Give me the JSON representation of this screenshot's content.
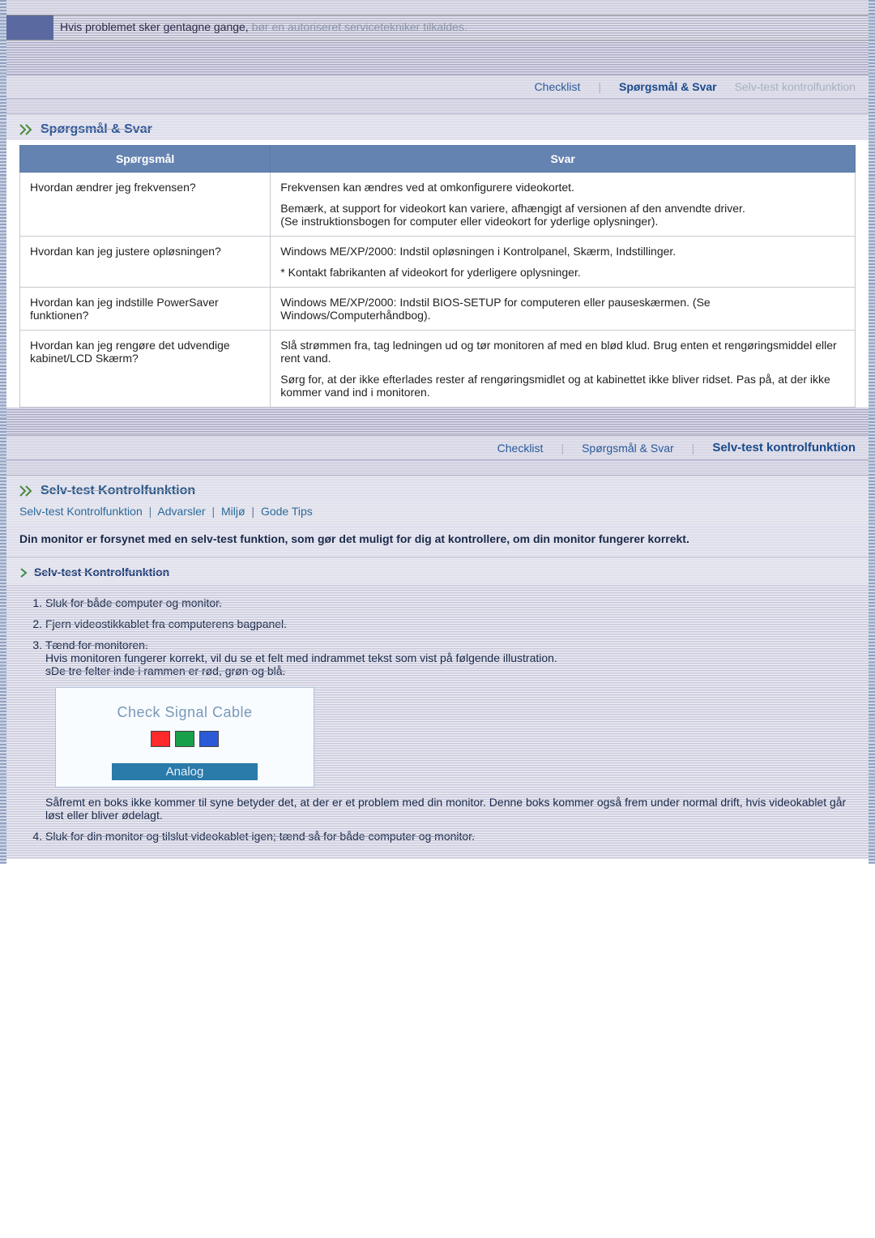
{
  "topNote": {
    "prefix": "Hvis problemet sker gentagne gange, ",
    "fadedSuffix": "bør en autoriseret servicetekniker tilkaldes."
  },
  "subnav1": {
    "checklist": "Checklist",
    "qa": "Spørgsmål & Svar",
    "selftest": "Selv-test kontrolfunktion"
  },
  "qaSection": {
    "title": "Spørgsmål & Svar",
    "headerQ": "Spørgsmål",
    "headerA": "Svar",
    "rows": [
      {
        "q": "Hvordan ændrer jeg frekvensen?",
        "a": [
          "Frekvensen kan ændres ved at omkonfigurere videokortet.",
          "Bemærk, at support for videokort kan variere, afhængigt af versionen af den anvendte driver.\n(Se instruktionsbogen for computer eller videokort for yderlige oplysninger)."
        ]
      },
      {
        "q": "Hvordan kan jeg justere opløsningen?",
        "a": [
          "Windows ME/XP/2000: Indstil opløsningen i Kontrolpanel, Skærm, Indstillinger.",
          "* Kontakt fabrikanten af videokort for yderligere oplysninger."
        ]
      },
      {
        "q": "Hvordan kan jeg indstille PowerSaver funktionen?",
        "a": [
          "Windows ME/XP/2000: Indstil BIOS-SETUP for computeren eller pauseskærmen. (Se Windows/Computerhåndbog)."
        ]
      },
      {
        "q": "Hvordan kan jeg rengøre det udvendige kabinet/LCD Skærm?",
        "a": [
          "Slå strømmen fra, tag ledningen ud og tør monitoren af med en blød klud. Brug enten et rengøringsmiddel eller rent vand.",
          "Sørg for, at der ikke efterlades rester af rengøringsmidlet og at kabinettet ikke bliver ridset. Pas på, at der ikke kommer vand ind i monitoren."
        ]
      }
    ]
  },
  "subnav2": {
    "checklist": "Checklist",
    "qa": "Spørgsmål & Svar",
    "selftest": "Selv-test kontrolfunktion"
  },
  "selftestSection": {
    "title": "Selv-test Kontrolfunktion",
    "sublinks": {
      "l1": "Selv-test Kontrolfunktion",
      "l2": "Advarsler",
      "l3": "Miljø",
      "l4": "Gode Tips"
    },
    "intro": "Din monitor er forsynet med en selv-test funktion, som gør det muligt for dig at kontrollere, om din monitor fungerer korrekt.",
    "miniHeader": "Selv-test Kontrolfunktion",
    "steps": {
      "s1": "Sluk for både computer og monitor.",
      "s2": "Fjern videostikkablet fra computerens bagpanel.",
      "s3a": "Tænd for monitoren.",
      "s3b": "Hvis monitoren fungerer korrekt, vil du se et felt med indrammet tekst som vist på følgende illustration.",
      "s3c": "sDe tre felter inde i rammen er rød, grøn og blå.",
      "s3note": "Såfremt en boks ikke kommer til syne betyder det, at der er et problem med din monitor. Denne boks kommer også frem under normal drift, hvis videokablet går løst eller bliver ødelagt.",
      "s4": "Sluk for din monitor og tilslut videokablet igen; tænd så for både computer og monitor."
    },
    "signalBox": {
      "title": "Check Signal Cable",
      "analog": "Analog"
    }
  }
}
